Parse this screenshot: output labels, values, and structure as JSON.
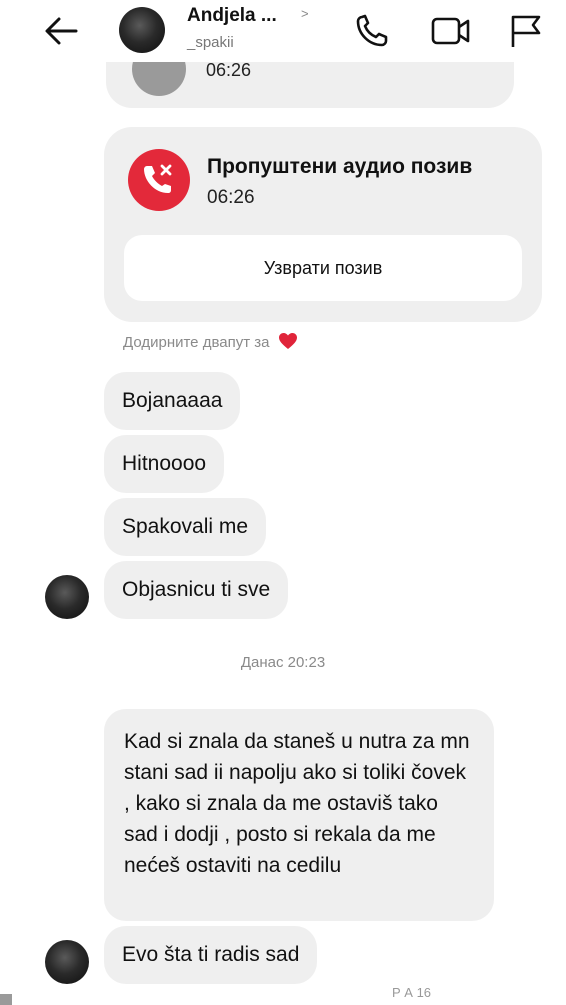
{
  "header": {
    "name": "Andjela ...",
    "chevron": ">",
    "username": "_spakii",
    "icons": [
      "back-arrow-icon",
      "phone-icon",
      "video-camera-icon",
      "flag-icon"
    ]
  },
  "previous_call": {
    "time": "06:26"
  },
  "call_card": {
    "title": "Пропуштени аудио позив",
    "time": "06:26",
    "callback_label": "Узврати позив",
    "icon": "missed-call-icon",
    "icon_color": "#e3293a"
  },
  "react_hint": "Додирните двапут за",
  "messages_group1": [
    "Bojanaaaa",
    "Hitnoooo",
    "Spakovali me",
    "Objasnicu ti sve"
  ],
  "timestamp": "Данас 20:23",
  "messages_group2": [
    "Kad si znala da staneš u nutra za mn stani sad ii napolju ako si toliki čovek , kako si znala da me ostaviš tako sad i dodji , posto si rekala da me nećeš ostaviti na cedilu",
    "Evo šta ti radis sad"
  ],
  "footer_fragment": "Р  А           16",
  "colors": {
    "bubble": "#efefef",
    "accent_red": "#e3293a",
    "meta_text": "#8a8a8a"
  }
}
